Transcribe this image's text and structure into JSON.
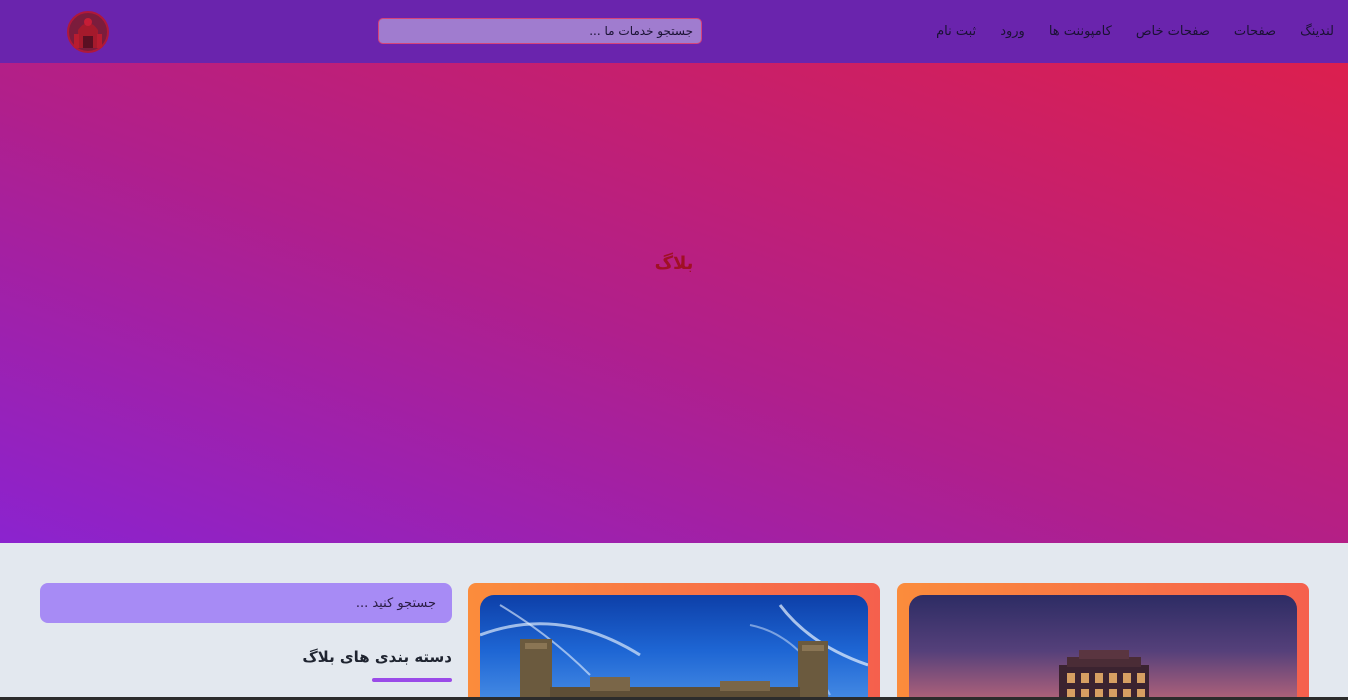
{
  "nav": {
    "links": [
      "لندینگ",
      "صفحات",
      "صفحات خاص",
      "کامپوننت ها",
      "ورود",
      "ثبت نام"
    ],
    "search_placeholder": "جستجو خدمات ما ...",
    "logo": "logo-icon"
  },
  "hero": {
    "title": "بلاگ"
  },
  "sidebar": {
    "search_placeholder": "جستجو کنید ...",
    "categories_heading": "دسته بندی های بلاگ"
  },
  "cards": [
    {
      "image": "palace-sunset-photo"
    },
    {
      "image": "ruins-sky-photo"
    }
  ],
  "colors": {
    "navbar": "#6a24ad",
    "hero_start": "#8b23cf",
    "hero_end": "#dc1f4e",
    "accent": "#9a4be8",
    "card_gradient_start": "#fb8c3c",
    "card_gradient_end": "#f5604d"
  }
}
